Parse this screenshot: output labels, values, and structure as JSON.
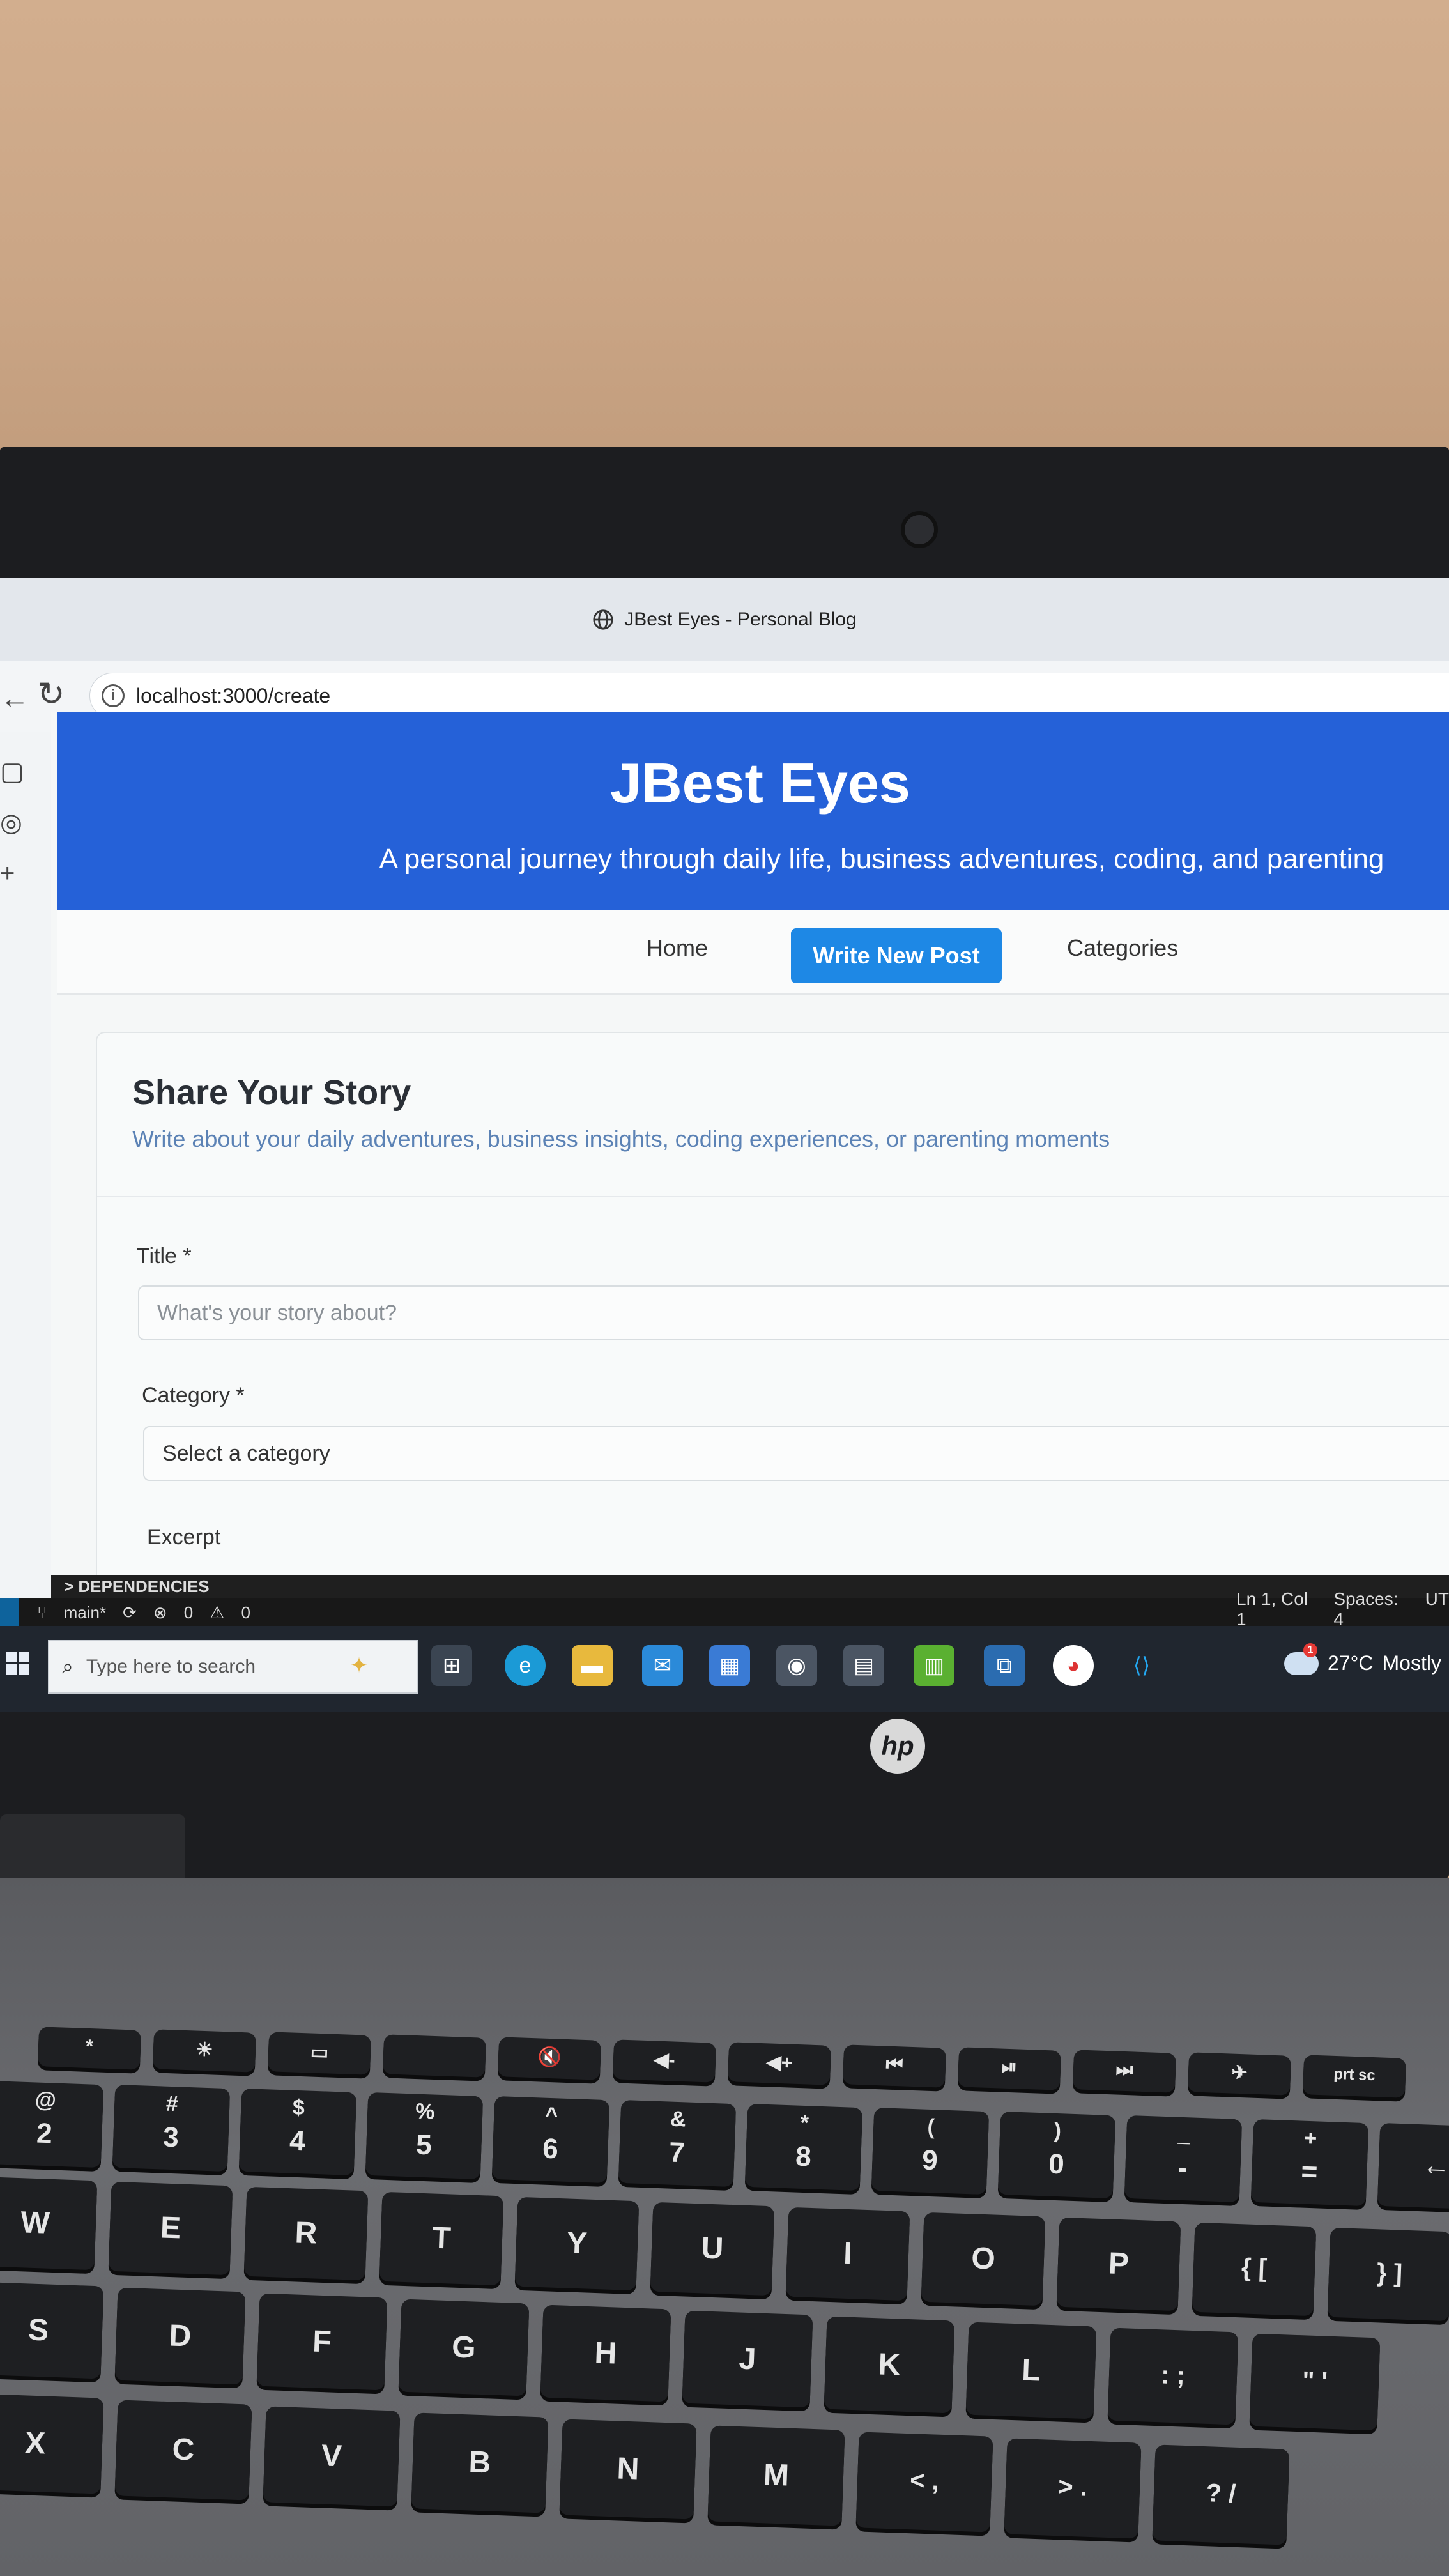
{
  "browser": {
    "window_title": "JBest Eyes - Personal Blog",
    "url": "localhost:3000/create"
  },
  "site": {
    "title": "JBest Eyes",
    "tagline": "A personal journey through daily life, business adventures, coding, and parenting",
    "nav": [
      {
        "label": "Home"
      },
      {
        "label": "Write New Post",
        "active": true
      },
      {
        "label": "Categories"
      }
    ],
    "accent_color": "#2561d8",
    "active_nav_color": "#1e88e5"
  },
  "form": {
    "heading": "Share Your Story",
    "subheading": "Write about your daily adventures, business insights, coding experiences, or parenting moments",
    "title_label": "Title *",
    "title_placeholder": "What's your story about?",
    "category_label": "Category *",
    "category_value": "Select a category",
    "excerpt_label": "Excerpt"
  },
  "editor_status": {
    "dependencies": "> DEPENDENCIES",
    "branch": "main*",
    "errors": "0",
    "warnings": "0",
    "cursor": "Ln 1, Col 1",
    "spaces": "Spaces: 4",
    "encoding_partial": "UT"
  },
  "taskbar": {
    "search_placeholder": "Type here to search",
    "weather": "27°C",
    "weather_text": "Mostly",
    "weather_badge": "1"
  },
  "laptop": {
    "brand": "hp"
  },
  "keyboard": {
    "fn_row": [
      "*",
      "☀",
      "▭",
      "",
      "🔇",
      "◀-",
      "◀+",
      "⏮",
      "⏯",
      "⏭",
      "✈",
      "prt sc"
    ],
    "number_row": [
      {
        "top": "@",
        "main": "2"
      },
      {
        "top": "#",
        "main": "3"
      },
      {
        "top": "$",
        "main": "4"
      },
      {
        "top": "%",
        "main": "5",
        "extra": "€"
      },
      {
        "top": "^",
        "main": "6"
      },
      {
        "top": "&",
        "main": "7"
      },
      {
        "top": "*",
        "main": "8"
      },
      {
        "top": "(",
        "main": "9"
      },
      {
        "top": ")",
        "main": "0"
      },
      {
        "top": "_",
        "main": "-"
      },
      {
        "top": "+",
        "main": "="
      },
      {
        "top": "",
        "main": "←"
      }
    ],
    "row_q": [
      "W",
      "E",
      "R",
      "T",
      "Y",
      "U",
      "I",
      "O",
      "P",
      "{ [",
      "} ]"
    ],
    "row_a": [
      "S",
      "D",
      "F",
      "G",
      "H",
      "J",
      "K",
      "L",
      ": ;",
      "\" '"
    ],
    "row_z": [
      "X",
      "C",
      "V",
      "B",
      "N",
      "M",
      "< ,",
      "> .",
      "? /"
    ]
  }
}
